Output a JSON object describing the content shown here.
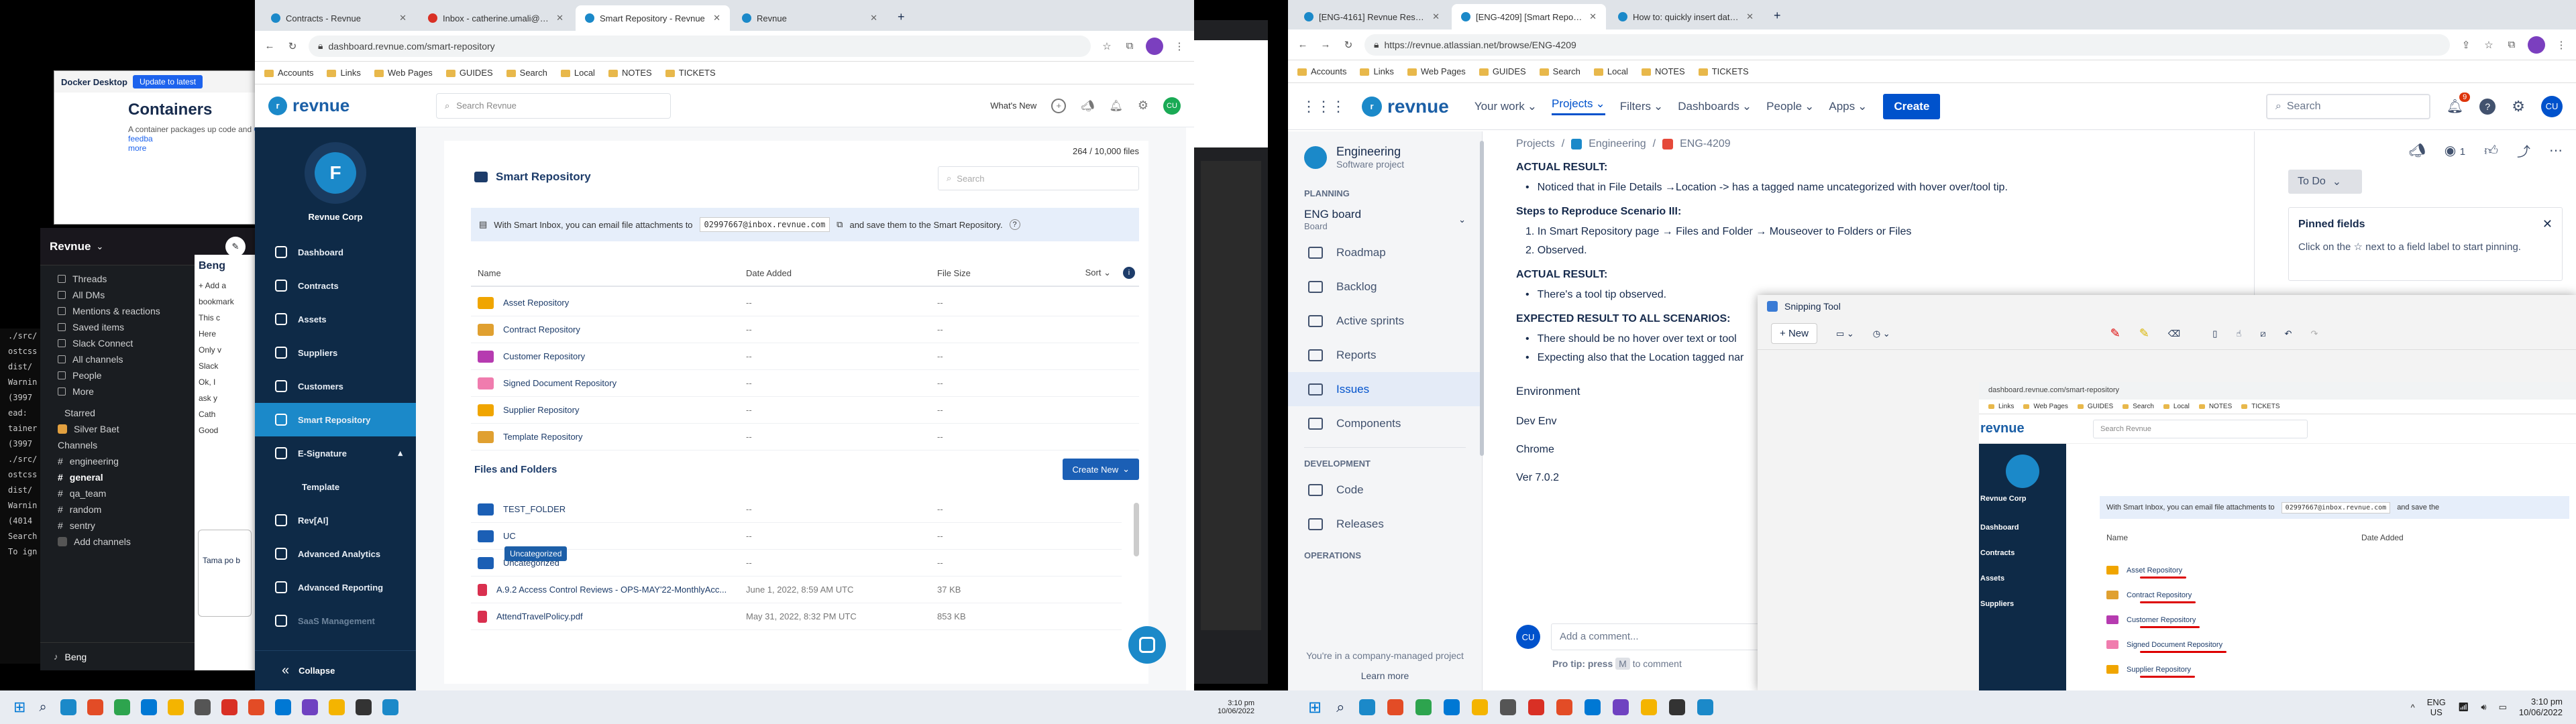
{
  "left_browser": {
    "tabs": [
      {
        "label": "Contracts - Revnue",
        "active": false
      },
      {
        "label": "Inbox - catherine.umali@revnue",
        "active": false
      },
      {
        "label": "Smart Repository - Revnue",
        "active": true
      },
      {
        "label": "Revnue",
        "active": false
      }
    ],
    "url": "dashboard.revnue.com/smart-repository",
    "bookmarks": [
      "Accounts",
      "Links",
      "Web Pages",
      "GUIDES",
      "Search",
      "Local",
      "NOTES",
      "TICKETS"
    ]
  },
  "revnue": {
    "logo": "revnue",
    "search_placeholder": "Search Revnue",
    "whats_new": "What's New",
    "avatar": "CU",
    "company": "Revnue Corp",
    "nav": [
      "Dashboard",
      "Contracts",
      "Assets",
      "Suppliers",
      "Customers",
      "Smart Repository",
      "E-Signature",
      "Template",
      "Rev[AI]",
      "Advanced Analytics",
      "Advanced Reporting",
      "SaaS Management"
    ],
    "collapse": "Collapse",
    "file_count": "264 / 10,000 files",
    "page_title": "Smart Repository",
    "search_placeholder2": "Search",
    "inbox_text_1": "With Smart Inbox, you can email file attachments to",
    "inbox_email": "02997667@inbox.revnue.com",
    "inbox_text_2": "and save them to the Smart Repository.",
    "col_name": "Name",
    "col_date": "Date Added",
    "col_size": "File Size",
    "sort": "Sort",
    "repos": [
      {
        "name": "Asset Repository",
        "date": "--",
        "size": "--",
        "color": "#f0a500"
      },
      {
        "name": "Contract Repository",
        "date": "--",
        "size": "--",
        "color": "#e0a030"
      },
      {
        "name": "Customer Repository",
        "date": "--",
        "size": "--",
        "color": "#b63bb0"
      },
      {
        "name": "Signed Document Repository",
        "date": "--",
        "size": "--",
        "color": "#f07cae"
      },
      {
        "name": "Supplier Repository",
        "date": "--",
        "size": "--",
        "color": "#f0a500"
      },
      {
        "name": "Template Repository",
        "date": "--",
        "size": "--",
        "color": "#e0a030"
      }
    ],
    "files_title": "Files and Folders",
    "create_new": "Create New",
    "files": [
      {
        "name": "TEST_FOLDER",
        "date": "--",
        "size": "--",
        "color": "#1b5fb5"
      },
      {
        "name": "UC",
        "date": "--",
        "size": "--",
        "color": "#1b5fb5"
      },
      {
        "name": "Uncategorized",
        "date": "--",
        "size": "--",
        "color": "#1b5fb5"
      },
      {
        "name": "A.9.2 Access Control Reviews - OPS-MAY'22-MonthlyAcc...",
        "date": "June 1, 2022, 8:59 AM UTC",
        "size": "37 KB",
        "color": "#d9304f"
      },
      {
        "name": "AttendTravelPolicy.pdf",
        "date": "May 31, 2022, 8:32 PM UTC",
        "size": "853 KB",
        "color": "#d9304f"
      }
    ],
    "tooltip": "Uncategorized"
  },
  "right_browser": {
    "tabs": [
      {
        "label": "[ENG-4161] Revnue Reskinning",
        "active": false
      },
      {
        "label": "[ENG-4209] [Smart Repository] H...",
        "active": true
      },
      {
        "label": "How to: quickly insert data - Eng...",
        "active": false
      }
    ],
    "url": "https://revnue.atlassian.net/browse/ENG-4209",
    "bookmarks": [
      "Accounts",
      "Links",
      "Web Pages",
      "GUIDES",
      "Search",
      "Local",
      "NOTES",
      "TICKETS"
    ]
  },
  "jira": {
    "logo": "revnue",
    "nav": [
      "Your work",
      "Projects",
      "Filters",
      "Dashboards",
      "People",
      "Apps"
    ],
    "create": "Create",
    "search": "Search",
    "notif_count": "9",
    "avatar": "CU",
    "project_name": "Engineering",
    "project_type": "Software project",
    "planning": "PLANNING",
    "board": "ENG board",
    "board_sub": "Board",
    "items": [
      "Roadmap",
      "Backlog",
      "Active sprints",
      "Reports",
      "Issues",
      "Components"
    ],
    "development": "DEVELOPMENT",
    "dev_items": [
      "Code",
      "Releases"
    ],
    "operations": "OPERATIONS",
    "managed": "You're in a company-managed project",
    "learn": "Learn more",
    "breadcrumb": [
      "Projects",
      "Engineering",
      "ENG-4209"
    ],
    "content": [
      {
        "type": "h",
        "text": "ACTUAL RESULT:"
      },
      {
        "type": "li",
        "text": "Noticed that in File Details →Location -> has a tagged name uncategorized with hover over/tool tip."
      },
      {
        "type": "h",
        "text": "Steps to Reproduce Scenario III:"
      },
      {
        "type": "ol",
        "text": "1. In Smart Repository page → Files and Folder → Mouseover to Folders or Files"
      },
      {
        "type": "ol",
        "text": "2. Observed."
      },
      {
        "type": "h",
        "text": "ACTUAL RESULT:"
      },
      {
        "type": "li",
        "text": "There's a tool tip observed."
      },
      {
        "type": "h",
        "text": "EXPECTED RESULT TO ALL SCENARIOS:"
      },
      {
        "type": "li",
        "text": "There should be no hover over text or tool"
      },
      {
        "type": "li",
        "text": "Expecting also that the Location tagged nar"
      }
    ],
    "env_title": "Environment",
    "env": [
      "Dev Env",
      "Chrome",
      "Ver 7.0.2"
    ],
    "comment_placeholder": "Add a comment...",
    "pro_tip": "Pro tip: press",
    "pro_key": "M",
    "pro_tip2": "to comment",
    "status": "To Do",
    "watch_count": "1",
    "pinned": "Pinned fields",
    "pinned_text": "Click on the ☆ next to a field label to start pinning."
  },
  "snipping": {
    "title": "Snipping Tool",
    "new": "New",
    "url": "dashboard.revnue.com/smart-repository",
    "bookmarks": [
      "Links",
      "Web Pages",
      "GUIDES",
      "Search",
      "Local",
      "NOTES",
      "TICKETS"
    ],
    "logo": "revnue",
    "search": "Search Revnue",
    "company": "Revnue Corp",
    "nav": [
      "Dashboard",
      "Contracts",
      "Assets",
      "Suppliers"
    ],
    "inbox_text": "With Smart Inbox, you can email file attachments to",
    "inbox_email": "02997667@inbox.revnue.com",
    "inbox_text2": "and save the",
    "col_name": "Name",
    "col_date": "Date Added",
    "repos": [
      "Asset Repository",
      "Contract Repository",
      "Customer Repository",
      "Signed Document Repository",
      "Supplier Repository"
    ]
  },
  "slack": {
    "workspace": "Revnue",
    "items": [
      "Threads",
      "All DMs",
      "Mentions & reactions",
      "Saved items",
      "Slack Connect",
      "All channels",
      "People",
      "More"
    ],
    "starred": "Starred",
    "starred_items": [
      "Silver Baet"
    ],
    "channels": "Channels",
    "channel_items": [
      "engineering",
      "general",
      "qa_team",
      "random",
      "sentry"
    ],
    "add_channels": "Add channels",
    "user": "Beng",
    "chat_title": "Beng",
    "chat_lines": [
      "+ Add a bookmark",
      "This c",
      "Here",
      "Only v",
      "Slack",
      "Ok, I",
      "ask y",
      "Cath",
      "Good"
    ],
    "compose": "Tama po b"
  },
  "docker": {
    "title": "Docker Desktop",
    "update": "Update to latest",
    "heading": "Containers",
    "feedback": "Give feedba",
    "desc": "A container packages up code and",
    "more": "more"
  },
  "terminal": [
    "./src/",
    "ostcss",
    "dist/",
    "Warnin",
    "(3997",
    "ead: ",
    "tainer",
    "(3997",
    "./src/",
    "ostcss",
    "dist/",
    "Warnin",
    "(4014",
    "Search",
    "To ign"
  ],
  "taskbar_left": {
    "time": "3:10 pm",
    "date": "10/06/2022"
  },
  "taskbar_right": {
    "lang": "ENG",
    "region": "US",
    "time": "3:10 pm",
    "date": "10/06/2022"
  }
}
